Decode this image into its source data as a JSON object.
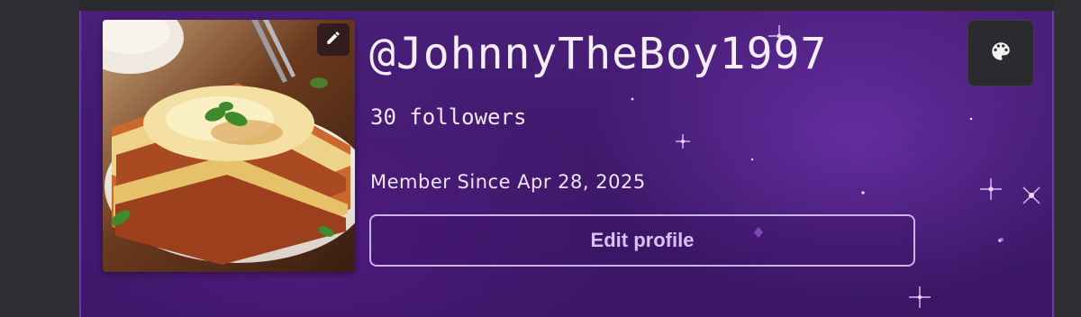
{
  "profile": {
    "username": "@JohnnyTheBoy1997",
    "followers": "30 followers",
    "member_since": "Member Since Apr 28, 2025",
    "edit_profile_label": "Edit profile",
    "avatar_alt": "lasagna",
    "edit_avatar_icon": "pencil-icon",
    "theme_icon": "palette-icon"
  },
  "colors": {
    "banner": "#3f1a6c",
    "button_border": "#c9b3ea",
    "button_text": "#d8c2f3",
    "text": "#f4eef8"
  }
}
